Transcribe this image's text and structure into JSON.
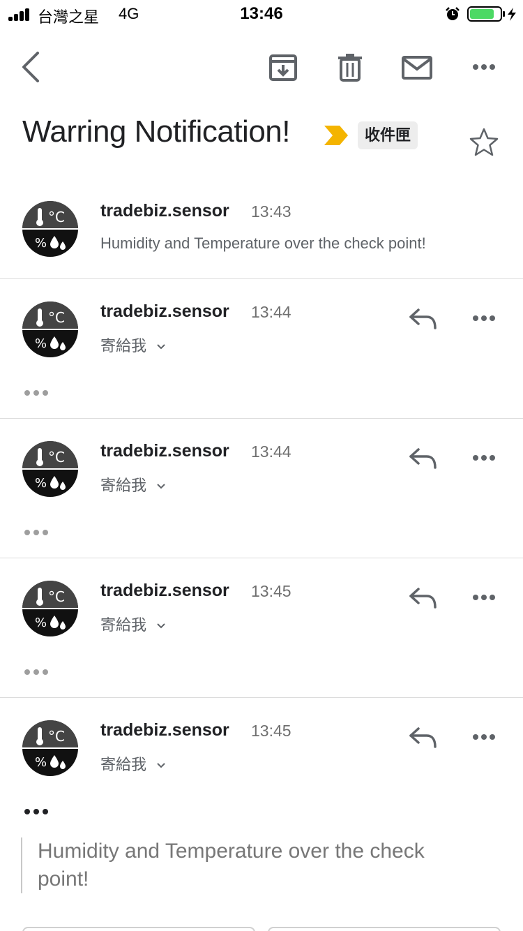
{
  "status_bar": {
    "carrier": "台灣之星",
    "network": "4G",
    "time": "13:46",
    "battery_color": "#4cd964"
  },
  "toolbar": {
    "back_icon": "chevron-left-icon",
    "archive_icon": "archive-icon",
    "delete_icon": "trash-icon",
    "mail_icon": "envelope-icon",
    "more_icon": "more-horizontal-icon"
  },
  "thread": {
    "subject": "Warring Notification!",
    "label": "收件匣",
    "important_color": "#f4b400"
  },
  "messages": [
    {
      "sender": "tradebiz.sensor",
      "time": "13:43",
      "snippet": "Humidity and Temperature over the check point!"
    },
    {
      "sender": "tradebiz.sensor",
      "time": "13:44",
      "recipient": "寄給我"
    },
    {
      "sender": "tradebiz.sensor",
      "time": "13:44",
      "recipient": "寄給我"
    },
    {
      "sender": "tradebiz.sensor",
      "time": "13:45",
      "recipient": "寄給我"
    },
    {
      "sender": "tradebiz.sensor",
      "time": "13:45",
      "recipient": "寄給我"
    }
  ],
  "expanded_body": {
    "quoted_text": "Humidity and Temperature over the check point!"
  }
}
